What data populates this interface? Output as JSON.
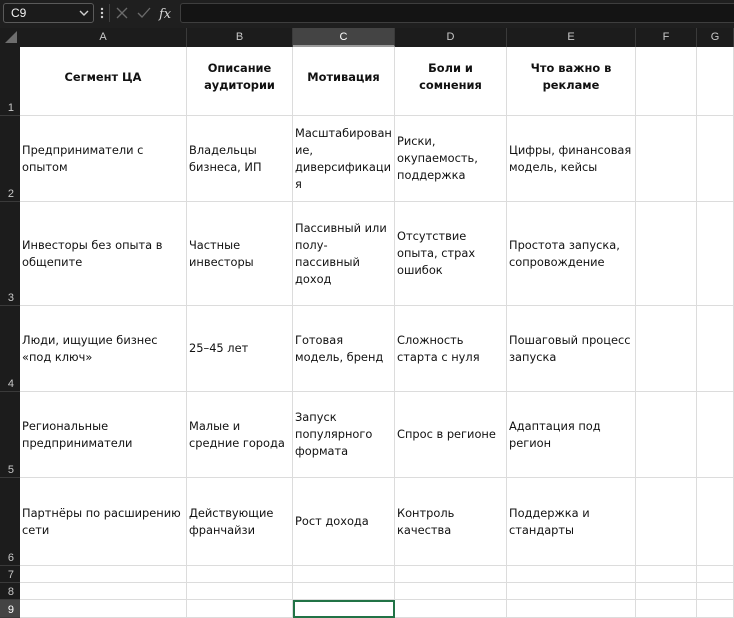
{
  "formula_bar": {
    "name_box": "C9",
    "formula": "",
    "icons": [
      "chevron-down-icon",
      "kebab-icon",
      "cancel-icon",
      "enter-icon",
      "function-icon"
    ]
  },
  "columns": [
    "A",
    "B",
    "C",
    "D",
    "E",
    "F",
    "G"
  ],
  "selected_column": "C",
  "active_cell": "C9",
  "rows": [
    "1",
    "2",
    "3",
    "4",
    "5",
    "6",
    "7",
    "8",
    "9"
  ],
  "table": {
    "headers": [
      "Сегмент ЦА",
      "Описание аудитории",
      "Мотивация",
      "Боли и сомнения",
      "Что важно в рекламе"
    ],
    "rows": [
      [
        "Предприниматели с опытом",
        "Владельцы бизнеса, ИП",
        "Масштабирование, диверсификация",
        "Риски, окупаемость, поддержка",
        "Цифры, финансовая модель, кейсы"
      ],
      [
        "Инвесторы без опыта в общепите",
        "Частные инвесторы",
        "Пассивный или полу-пассивный доход",
        "Отсутствие опыта, страх ошибок",
        "Простота запуска, сопровождение"
      ],
      [
        "Люди, ищущие бизнес «под ключ»",
        "25–45 лет",
        "Готовая модель, бренд",
        "Сложность старта с нуля",
        "Пошаговый процесс запуска"
      ],
      [
        "Региональные предприниматели",
        "Малые и средние города",
        "Запуск популярного формата",
        "Спрос в регионе",
        "Адаптация под регион"
      ],
      [
        "Партнёры по расширению сети",
        "Действующие франчайзи",
        "Рост дохода",
        "Контроль качества",
        "Поддержка и стандарты"
      ]
    ]
  }
}
